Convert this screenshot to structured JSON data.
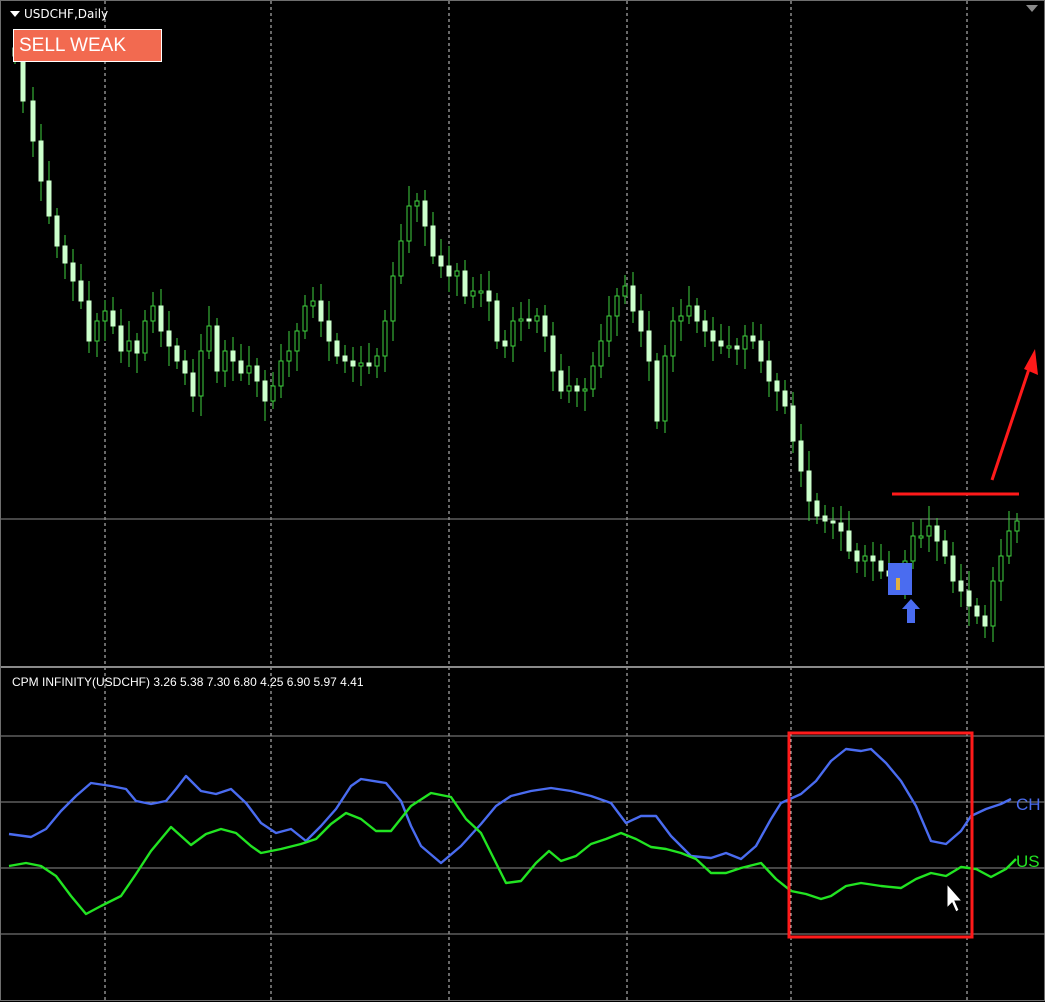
{
  "window": {
    "symbol_title": "USDCHF,Daily",
    "signal_badge": "SELL WEAK"
  },
  "indicator": {
    "label": "CPM INFINITY(USDCHF) 3.26 5.38 7.30 6.80 4.25 6.90 5.97 4.41",
    "series": [
      {
        "name": "CHF",
        "visible_label": "CH",
        "color": "#4a6cf0"
      },
      {
        "name": "USD",
        "visible_label": "US",
        "color": "#22e422"
      }
    ]
  },
  "colors": {
    "background": "#000000",
    "candle": "#ccffcc",
    "wick": "#3fd23f",
    "grid": "#cccccc",
    "annotation": "#ff1a1a",
    "highlight": "#4a6cf0"
  }
}
